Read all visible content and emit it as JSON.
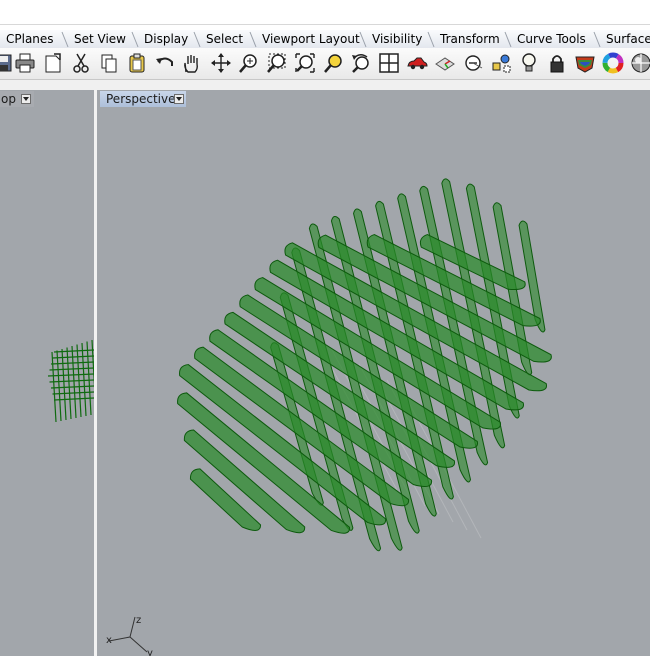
{
  "menu_tabs": [
    "CPlanes",
    "Set View",
    "Display",
    "Select",
    "Viewport Layout",
    "Visibility",
    "Transform",
    "Curve Tools",
    "Surface"
  ],
  "toolbar_icons": [
    "save-icon",
    "print-icon",
    "export-icon",
    "cut-icon",
    "copy-icon",
    "paste-icon",
    "undo-icon",
    "pan-hand-icon",
    "rotate-view-icon",
    "zoom-icon",
    "zoom-window-icon",
    "zoom-extents-icon",
    "zoom-selected-icon",
    "undo-view-icon",
    "four-viewports-icon",
    "car-icon",
    "named-view-icon",
    "cplane-icon",
    "shaded-mode-icon",
    "light-bulb-icon",
    "lock-icon",
    "render-icon",
    "color-wheel-icon",
    "material-sphere-icon"
  ],
  "viewports": {
    "left_label": "op",
    "main_label": "Perspective"
  },
  "axis_labels": {
    "z": "z",
    "x": "x",
    "y": "y"
  },
  "colors": {
    "viewport_bg": "#a2a6ab",
    "mesh_fill": "#2a8a2a",
    "mesh_stroke": "#0d5a0d",
    "active_label_bg": "#b8c8e0"
  }
}
